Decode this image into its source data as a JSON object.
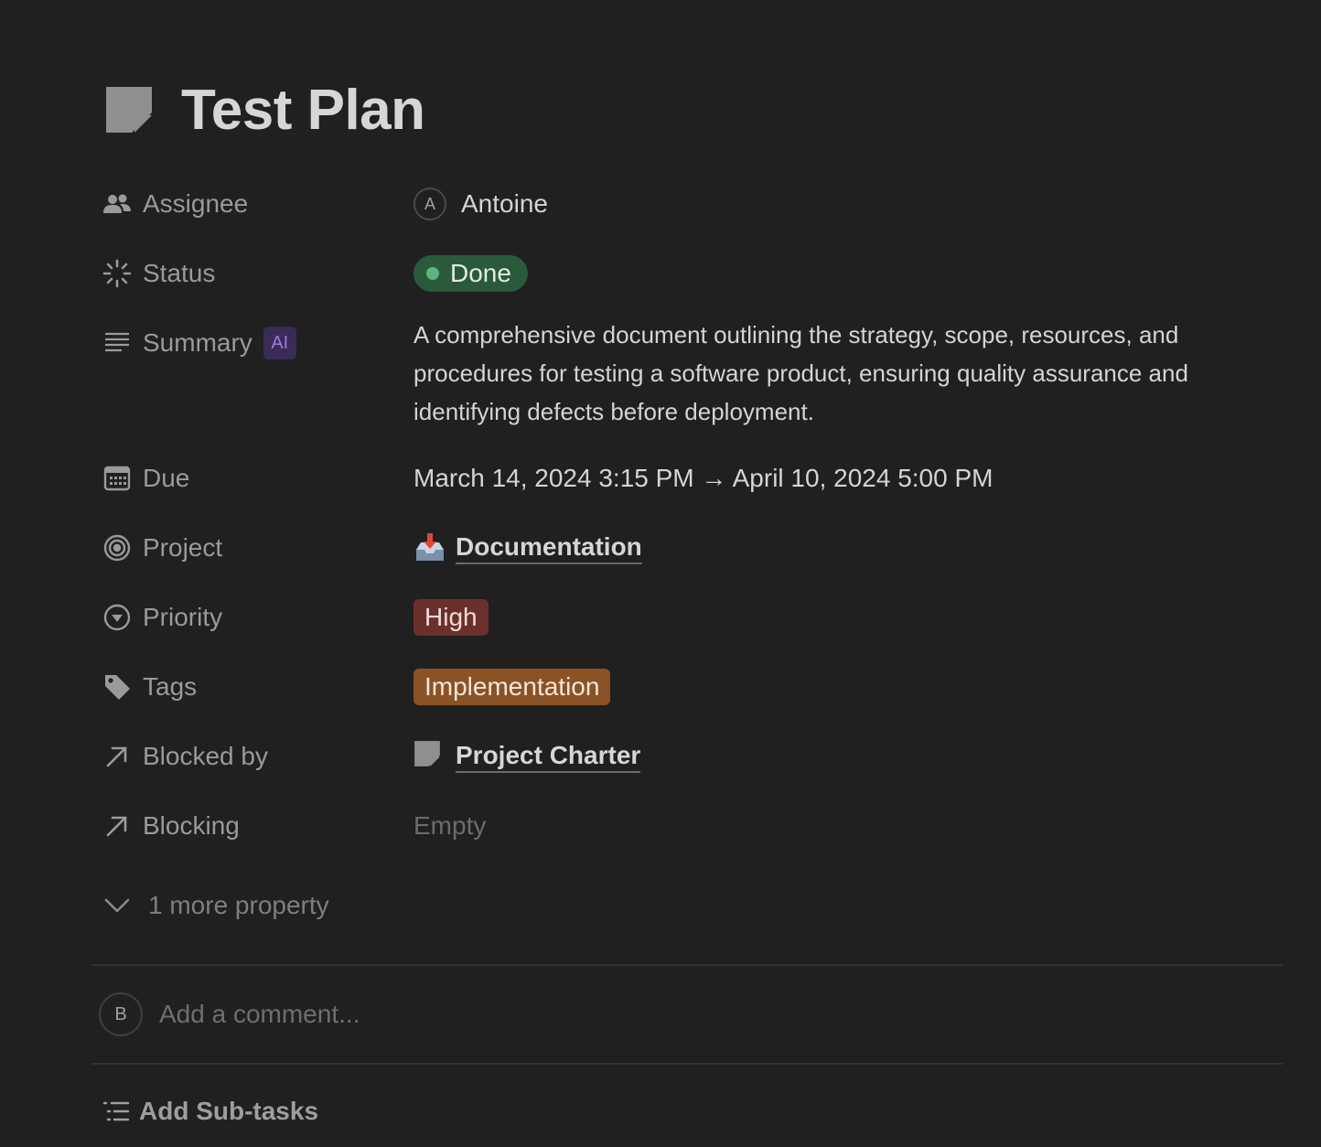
{
  "page": {
    "icon": "page-icon",
    "title": "Test Plan"
  },
  "properties": {
    "assignee": {
      "label": "Assignee",
      "icon": "people-icon",
      "avatar_initial": "A",
      "value": "Antoine"
    },
    "status": {
      "label": "Status",
      "icon": "status-spinner-icon",
      "value": "Done",
      "color": "#2b5a3b",
      "dot_color": "#5fb37c"
    },
    "summary": {
      "label": "Summary",
      "icon": "text-lines-icon",
      "badge": "AI",
      "value": "A comprehensive document outlining the strategy, scope, resources, and procedures for testing a software product, ensuring quality assurance and identifying defects before deployment."
    },
    "due": {
      "label": "Due",
      "icon": "calendar-icon",
      "value": "March 14, 2024 3:15 PM → April 10, 2024 5:00 PM"
    },
    "project": {
      "label": "Project",
      "icon": "target-icon",
      "value_icon": "inbox-tray-icon",
      "value": "Documentation"
    },
    "priority": {
      "label": "Priority",
      "icon": "chevron-circle-icon",
      "value": "High",
      "color": "#6b2f2c"
    },
    "tags": {
      "label": "Tags",
      "icon": "tag-icon",
      "value": "Implementation",
      "color": "#8a5225"
    },
    "blocked_by": {
      "label": "Blocked by",
      "icon": "arrow-up-right-icon",
      "value_icon": "page-icon",
      "value": "Project Charter"
    },
    "blocking": {
      "label": "Blocking",
      "icon": "arrow-up-right-icon",
      "value": "Empty"
    }
  },
  "more_properties": {
    "icon": "chevron-down-icon",
    "label": "1 more property"
  },
  "comment": {
    "avatar_initial": "B",
    "placeholder": "Add a comment..."
  },
  "subtasks": {
    "icon": "list-icon",
    "label": "Add Sub-tasks"
  }
}
